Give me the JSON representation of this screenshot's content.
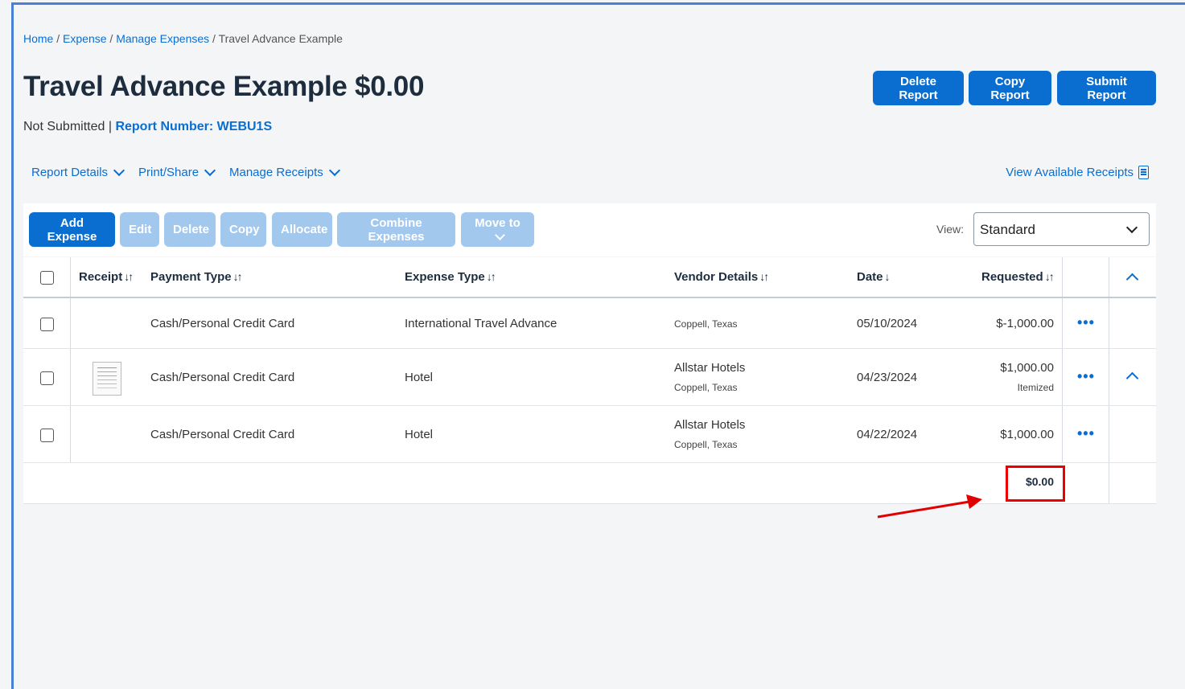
{
  "breadcrumb": {
    "home": "Home",
    "expense": "Expense",
    "manage": "Manage Expenses",
    "current": "Travel Advance Example",
    "separator": "/"
  },
  "report": {
    "title": "Travel Advance Example $0.00",
    "status": "Not Submitted |",
    "report_number": "Report Number: WEBU1S"
  },
  "header_buttons": {
    "delete": "Delete Report",
    "copy": "Copy Report",
    "submit": "Submit Report"
  },
  "subnav": {
    "report_details": "Report Details",
    "print_share": "Print/Share",
    "manage_receipts": "Manage Receipts",
    "view_receipts": "View Available Receipts"
  },
  "toolbar": {
    "add": "Add Expense",
    "edit": "Edit",
    "delete": "Delete",
    "copy": "Copy",
    "allocate": "Allocate",
    "combine": "Combine Expenses",
    "move": "Move to",
    "view_label": "View:",
    "view_value": "Standard"
  },
  "table": {
    "headers": {
      "receipt": "Receipt",
      "payment_type": "Payment Type",
      "expense_type": "Expense Type",
      "vendor": "Vendor Details",
      "date": "Date",
      "requested": "Requested",
      "sort_glyph": "↓↑",
      "date_sort_glyph": "↓"
    },
    "rows": [
      {
        "payment_type": "Cash/Personal Credit Card",
        "expense_type": "International Travel Advance",
        "vendor_name": "",
        "vendor_location": "Coppell, Texas",
        "date": "05/10/2024",
        "requested": "$-1,000.00",
        "note": ""
      },
      {
        "payment_type": "Cash/Personal Credit Card",
        "expense_type": "Hotel",
        "vendor_name": "Allstar Hotels",
        "vendor_location": "Coppell, Texas",
        "date": "04/23/2024",
        "requested": "$1,000.00",
        "note": "Itemized"
      },
      {
        "payment_type": "Cash/Personal Credit Card",
        "expense_type": "Hotel",
        "vendor_name": "Allstar Hotels",
        "vendor_location": "Coppell, Texas",
        "date": "04/22/2024",
        "requested": "$1,000.00",
        "note": ""
      }
    ],
    "total": "$0.00",
    "more_glyph": "•••"
  },
  "colors": {
    "accent": "#0a6ed1",
    "disabled": "#a3c8ee",
    "annotation": "#e00000"
  }
}
